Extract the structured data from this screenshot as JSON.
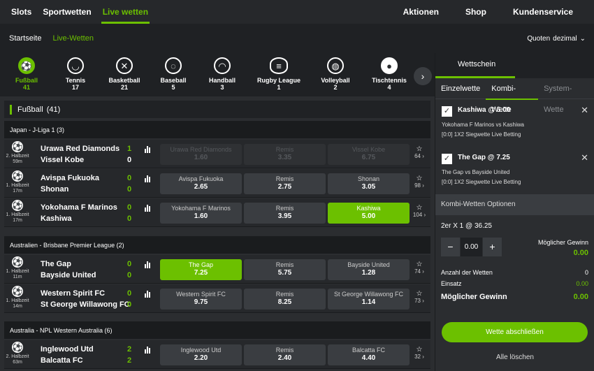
{
  "nav": {
    "left": [
      "Slots",
      "Sportwetten",
      "Live wetten"
    ],
    "right": [
      "Aktionen",
      "Shop",
      "Kundenservice"
    ]
  },
  "subnav": {
    "crumbs": [
      "Startseite",
      "Live-Wetten"
    ],
    "odds_label": "Quoten",
    "odds_value": "dezimal"
  },
  "sports": [
    {
      "name": "Fußball",
      "count": "41",
      "icon": "soccer-ball-icon"
    },
    {
      "name": "Tennis",
      "count": "17",
      "icon": "tennis-ball-icon"
    },
    {
      "name": "Basketball",
      "count": "21",
      "icon": "basketball-icon"
    },
    {
      "name": "Baseball",
      "count": "5",
      "icon": "baseball-icon"
    },
    {
      "name": "Handball",
      "count": "3",
      "icon": "handball-icon"
    },
    {
      "name": "Rugby League",
      "count": "1",
      "icon": "rugby-ball-icon"
    },
    {
      "name": "Volleyball",
      "count": "2",
      "icon": "volleyball-icon"
    },
    {
      "name": "Tischtennis",
      "count": "4",
      "icon": "table-tennis-icon"
    }
  ],
  "section": {
    "title": "Fußball",
    "count": "(41)"
  },
  "leagues": {
    "l1": "Japan - J-Liga 1 (3)",
    "l2": "Australien - Brisbane Premier League (2)",
    "l3": "Australia - NPL Western Australia (6)"
  },
  "matches": [
    {
      "period": "2. Halbzeit",
      "minute": "59m",
      "home": "Urawa Red Diamonds",
      "away": "Vissel Kobe",
      "hs": "1",
      "as": "0",
      "o1n": "Urawa Red Diamonds",
      "o1": "1.60",
      "o2n": "Remis",
      "o2": "3.35",
      "o3n": "Vissel Kobe",
      "o3": "6.75",
      "more": "64"
    },
    {
      "period": "1. Halbzeit",
      "minute": "17m",
      "home": "Avispa Fukuoka",
      "away": "Shonan",
      "hs": "0",
      "as": "0",
      "o1n": "Avispa Fukuoka",
      "o1": "2.65",
      "o2n": "Remis",
      "o2": "2.75",
      "o3n": "Shonan",
      "o3": "3.05",
      "more": "98"
    },
    {
      "period": "1. Halbzeit",
      "minute": "17m",
      "home": "Yokohama F Marinos",
      "away": "Kashiwa",
      "hs": "0",
      "as": "0",
      "o1n": "Yokohama F Marinos",
      "o1": "1.60",
      "o2n": "Remis",
      "o2": "3.95",
      "o3n": "Kashiwa",
      "o3": "5.00",
      "more": "104"
    },
    {
      "period": "1. Halbzeit",
      "minute": "11m",
      "home": "The Gap",
      "away": "Bayside United",
      "hs": "0",
      "as": "0",
      "o1n": "The Gap",
      "o1": "7.25",
      "o2n": "Remis",
      "o2": "5.75",
      "o3n": "Bayside United",
      "o3": "1.28",
      "more": "74"
    },
    {
      "period": "1. Halbzeit",
      "minute": "14m",
      "home": "Western Spirit FC",
      "away": "St George Willawong FC",
      "hs": "0",
      "as": "0",
      "o1n": "Western Spirit FC",
      "o1": "9.75",
      "o2n": "Remis",
      "o2": "8.25",
      "o3n": "St George Willawong FC",
      "o3": "1.14",
      "more": "73"
    },
    {
      "period": "2. Halbzeit",
      "minute": "63m",
      "home": "Inglewood Utd",
      "away": "Balcatta FC",
      "hs": "2",
      "as": "2",
      "o1n": "Inglewood Utd",
      "o1": "2.20",
      "o2n": "Remis",
      "o2": "2.40",
      "o3n": "Balcatta FC",
      "o3": "4.40",
      "more": "32"
    }
  ],
  "betslip": {
    "title": "Wettschein",
    "tabs": [
      "Einzelwette",
      "Kombi-Wette",
      "System-Wette"
    ],
    "selections": [
      {
        "title": "Kashiwa @ 5.00",
        "match": "Yokohama F Marinos vs Kashiwa",
        "market": "[0:0] 1X2 Siegwette Live Betting"
      },
      {
        "title": "The Gap @ 7.25",
        "match": "The Gap vs Bayside United",
        "market": "[0:0] 1X2 Siegwette Live Betting"
      }
    ],
    "options_title": "Kombi-Wetten Optionen",
    "combo": "2er X 1 @ 36.25",
    "stake": "0.00",
    "gain_label": "Möglicher Gewinn",
    "gain_value": "0.00",
    "count_label": "Anzahl der Wetten",
    "count_value": "0",
    "einsatz_label": "Einsatz",
    "einsatz_value": "0.00",
    "total_label": "Möglicher Gewinn",
    "total_value": "0.00",
    "cta": "Wette abschließen",
    "clear": "Alle löschen"
  },
  "colors": {
    "accent": "#6cc000",
    "bg": "#2b2d30"
  }
}
